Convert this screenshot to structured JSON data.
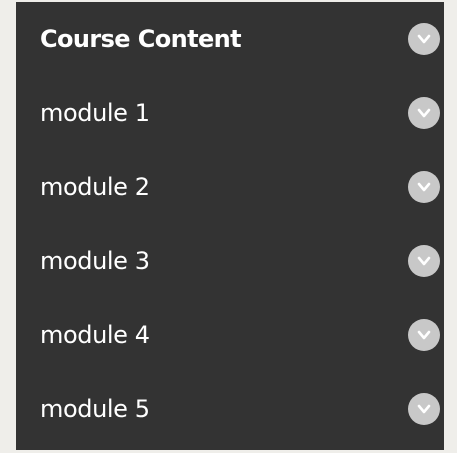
{
  "menu": {
    "header": {
      "label": "Course Content",
      "icon": "chevron-down-icon"
    },
    "items": [
      {
        "label": "module 1",
        "icon": "chevron-down-icon"
      },
      {
        "label": "module 2",
        "icon": "chevron-down-icon"
      },
      {
        "label": "module 3",
        "icon": "chevron-down-icon"
      },
      {
        "label": "module 4",
        "icon": "chevron-down-icon"
      },
      {
        "label": "module 5",
        "icon": "chevron-down-icon"
      }
    ]
  },
  "colors": {
    "page_background": "#efeeea",
    "panel_background": "#333333",
    "text": "#ffffff",
    "chevron_circle": "#c8c8c8",
    "chevron_stroke": "#ffffff"
  }
}
